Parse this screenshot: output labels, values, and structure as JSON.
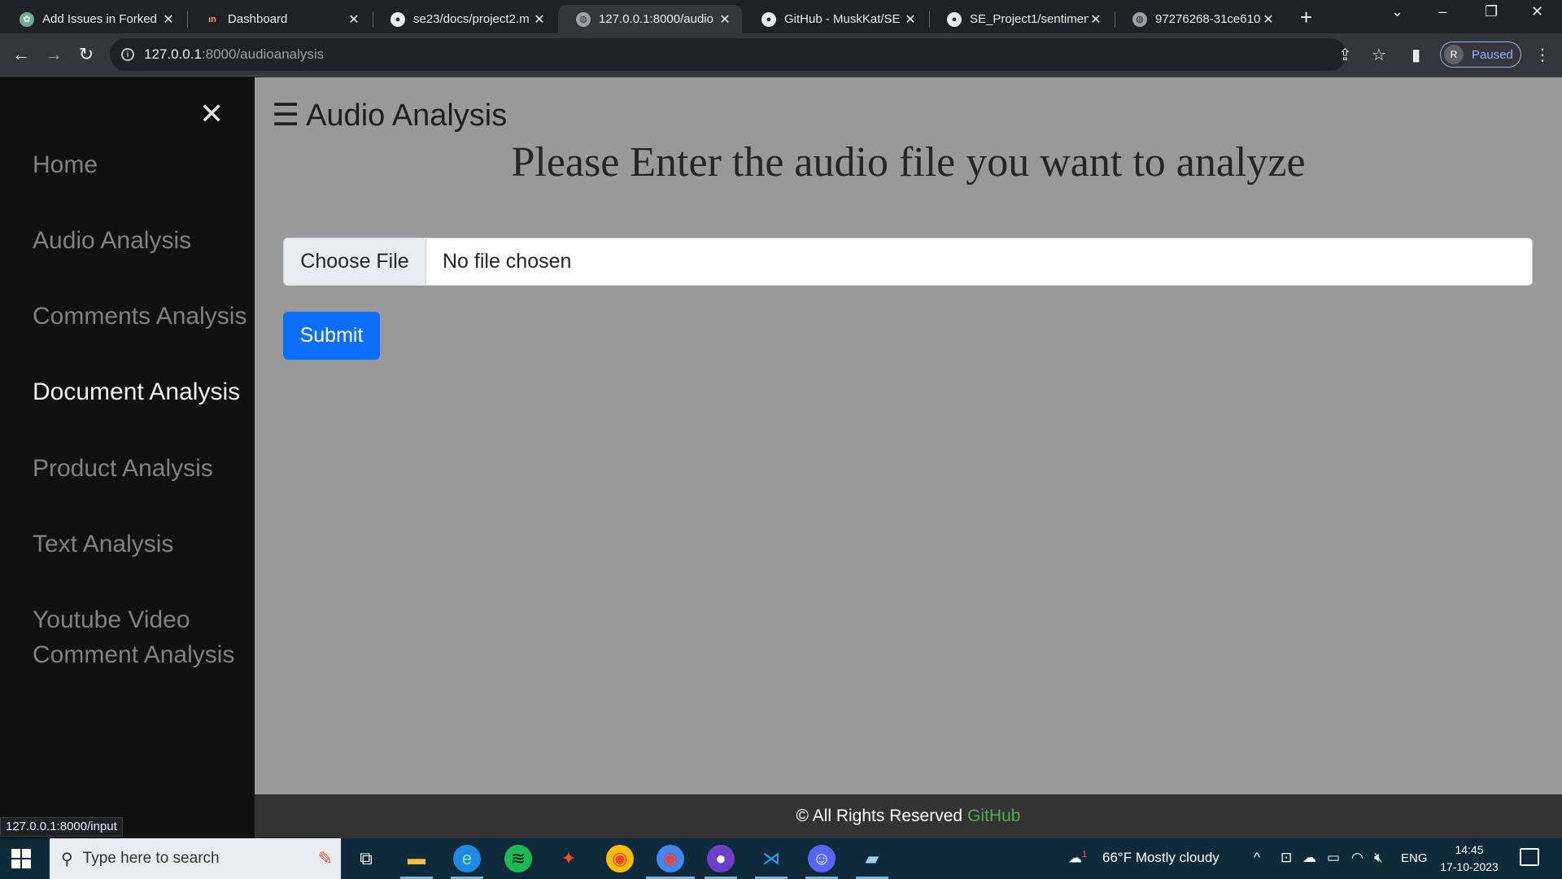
{
  "browser": {
    "tabs": [
      {
        "title": "Add Issues in Forked",
        "favicon": "openai-icon",
        "active": false
      },
      {
        "title": "Dashboard",
        "favicon": "dashboard-icon",
        "active": false
      },
      {
        "title": "se23/docs/project2.m",
        "favicon": "github-icon",
        "active": false
      },
      {
        "title": "127.0.0.1:8000/audio",
        "favicon": "globe-icon",
        "active": true
      },
      {
        "title": "GitHub - MuskKat/SE",
        "favicon": "github-icon",
        "active": false
      },
      {
        "title": "SE_Project1/sentimen",
        "favicon": "github-icon",
        "active": false
      },
      {
        "title": "97276268-31ce6100-",
        "favicon": "globe-icon",
        "active": false
      }
    ],
    "url_host": "127.0.0.1",
    "url_path": ":8000/audioanalysis",
    "profile_initial": "R",
    "profile_status": "Paused",
    "status_url": "127.0.0.1:8000/input"
  },
  "sidebar": {
    "items": [
      {
        "label": "Home"
      },
      {
        "label": "Audio Analysis"
      },
      {
        "label": "Comments Analysis"
      },
      {
        "label": "Document Analysis"
      },
      {
        "label": "Product Analysis"
      },
      {
        "label": "Text Analysis"
      },
      {
        "label": "Youtube Video Comment Analysis"
      }
    ]
  },
  "main": {
    "title_icon": "☰",
    "title": "Audio Analysis",
    "heading": "Please Enter the audio file you want to analyze",
    "file_button": "Choose File",
    "file_status": "No file chosen",
    "submit_label": "Submit"
  },
  "footer": {
    "text": "© All Rights Reserved",
    "link": "GitHub"
  },
  "taskbar": {
    "search_placeholder": "Type here to search",
    "weather": "66°F  Mostly cloudy",
    "weather_badge": "1",
    "language": "ENG",
    "time": "14:45",
    "date": "17-10-2023"
  },
  "colors": {
    "sidebar_bg": "#111111",
    "page_bg": "#999999",
    "submit_bg": "#0d6efd",
    "footer_bg": "#333333",
    "footer_link": "#4caf50"
  }
}
